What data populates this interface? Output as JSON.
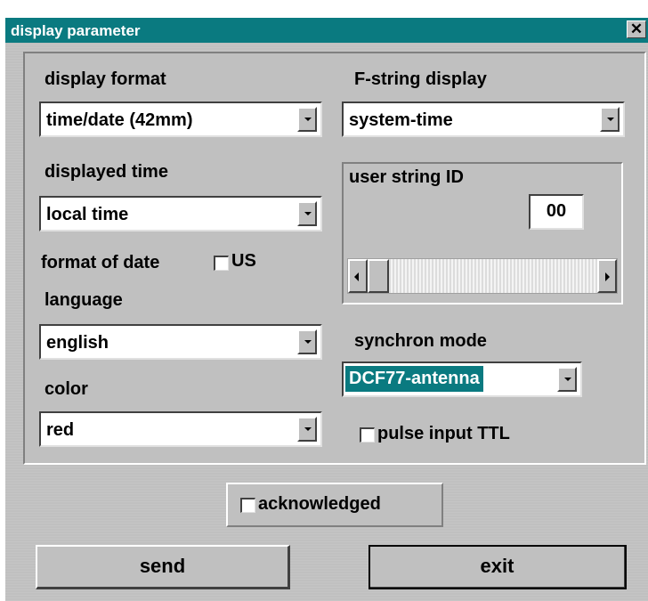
{
  "window": {
    "title": "display parameter",
    "close_label": "✕"
  },
  "left": {
    "display_format_label": "display format",
    "display_format_value": "time/date (42mm)",
    "displayed_time_label": "displayed time",
    "displayed_time_value": "local time",
    "format_of_date_label": "format of date",
    "us_label": "US",
    "language_label": "language",
    "language_value": "english",
    "color_label": "color",
    "color_value": "red"
  },
  "right": {
    "f_string_label": "F-string display",
    "f_string_value": "system-time",
    "user_string_label": "user string ID",
    "user_string_value": "00",
    "synchron_mode_label": "synchron mode",
    "synchron_mode_value": "DCF77-antenna",
    "pulse_input_label": "pulse input TTL"
  },
  "acknowledged_label": "acknowledged",
  "buttons": {
    "send": "send",
    "exit": "exit"
  },
  "colors": {
    "title_bar": "#0a7a80",
    "dialog_bg": "#c0c0c0"
  }
}
